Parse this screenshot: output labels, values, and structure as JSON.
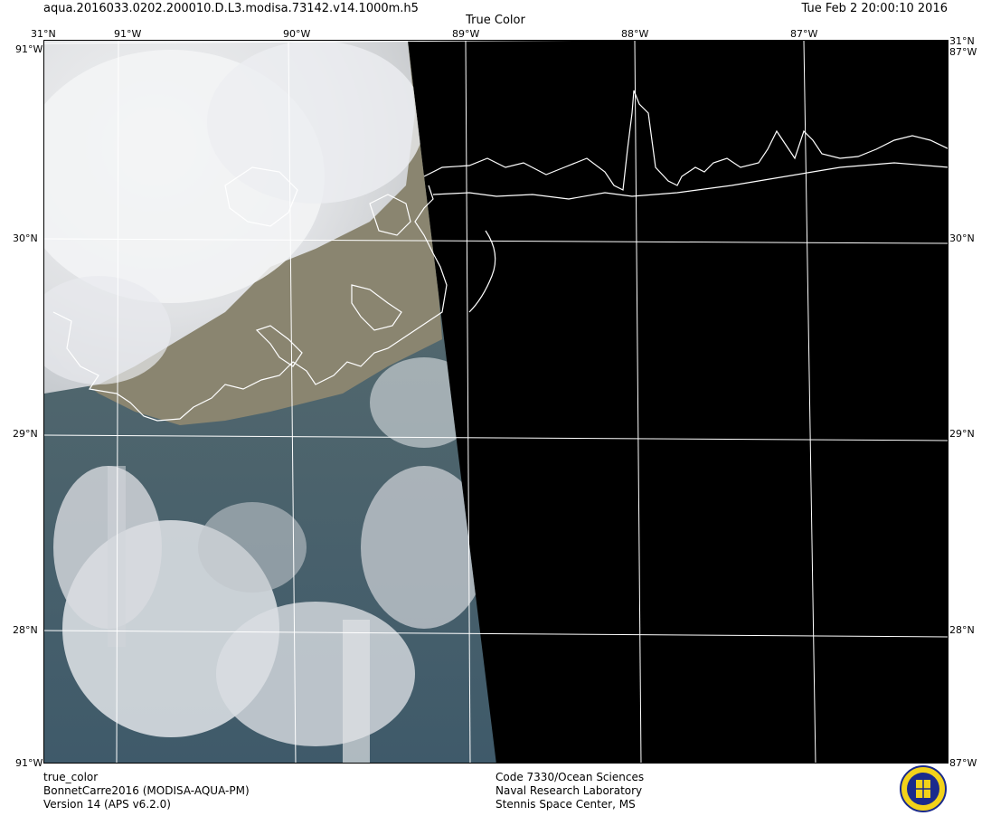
{
  "header": {
    "filename": "aqua.2016033.0202.200010.D.L3.modisa.73142.v14.1000m.h5",
    "title": "True Color",
    "timestamp": "Tue Feb  2 20:00:10 2016"
  },
  "axes": {
    "lon_labels": [
      "91°W",
      "90°W",
      "89°W",
      "88°W",
      "87°W"
    ],
    "lat_labels": [
      "31°N",
      "30°N",
      "29°N",
      "28°N"
    ],
    "corner_lon_left": "91°W",
    "corner_lon_right": "87°W"
  },
  "footer": {
    "left": [
      "true_color",
      "BonnetCarre2016 (MODISA-AQUA-PM)",
      "Version 14 (APS v6.2.0)"
    ],
    "middle": [
      "Code 7330/Ocean Sciences",
      "Naval Research Laboratory",
      "Stennis Space Center, MS"
    ]
  },
  "colors": {
    "cloud": "#e6e8ec",
    "water": "#4f6a6c",
    "land": "#8c8670",
    "night": "#000000",
    "grid": "#ffffff",
    "coast": "#ffffff",
    "logo_blue": "#1a2a8c",
    "logo_yellow": "#f2d21a"
  },
  "icons": {
    "logo": "nrl-emblem-icon"
  }
}
